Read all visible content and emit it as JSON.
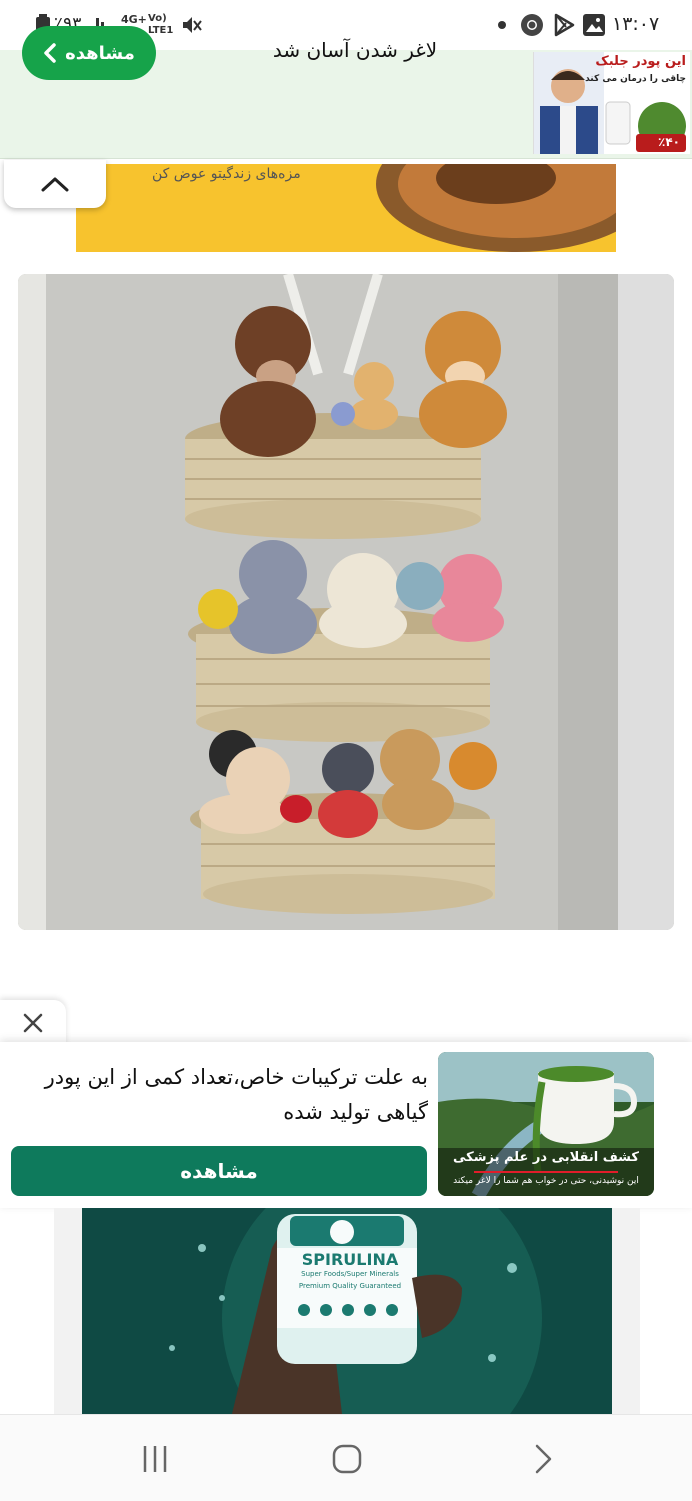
{
  "status_bar": {
    "time": "۱۳:۰۷",
    "battery": "٪۹۳",
    "network": "4G+",
    "volte": "Vo) LTE1"
  },
  "top_ad": {
    "button_label": "مشاهده",
    "headline": "لاغر شدن آسان شد",
    "thumb_title": "این پودر جلبک",
    "thumb_subtitle": "چاقی را درمان می کند",
    "thumb_discount": "٪۴۰"
  },
  "yellow_ad": {
    "caption": "مزه‌های زندگیتو عوض کن"
  },
  "notification_ad": {
    "text": "به علت ترکیبات خاص،تعداد کمی از این پودر گیاهی تولید شده",
    "button_label": "مشاهده",
    "image_title": "کشف انقلابی در علم پزشکی",
    "image_subtitle": "این نوشیدنی، حتی در خواب هم شما را لاغر میکند"
  },
  "product_image": {
    "brand": "SPIRULINA",
    "line1": "Super Foods/Super Minerals",
    "line2": "Premium Quality Guaranteed"
  },
  "colors": {
    "ad_green": "#16a34a",
    "notif_button": "#0e7a5c",
    "yellow": "#f7c32e"
  }
}
